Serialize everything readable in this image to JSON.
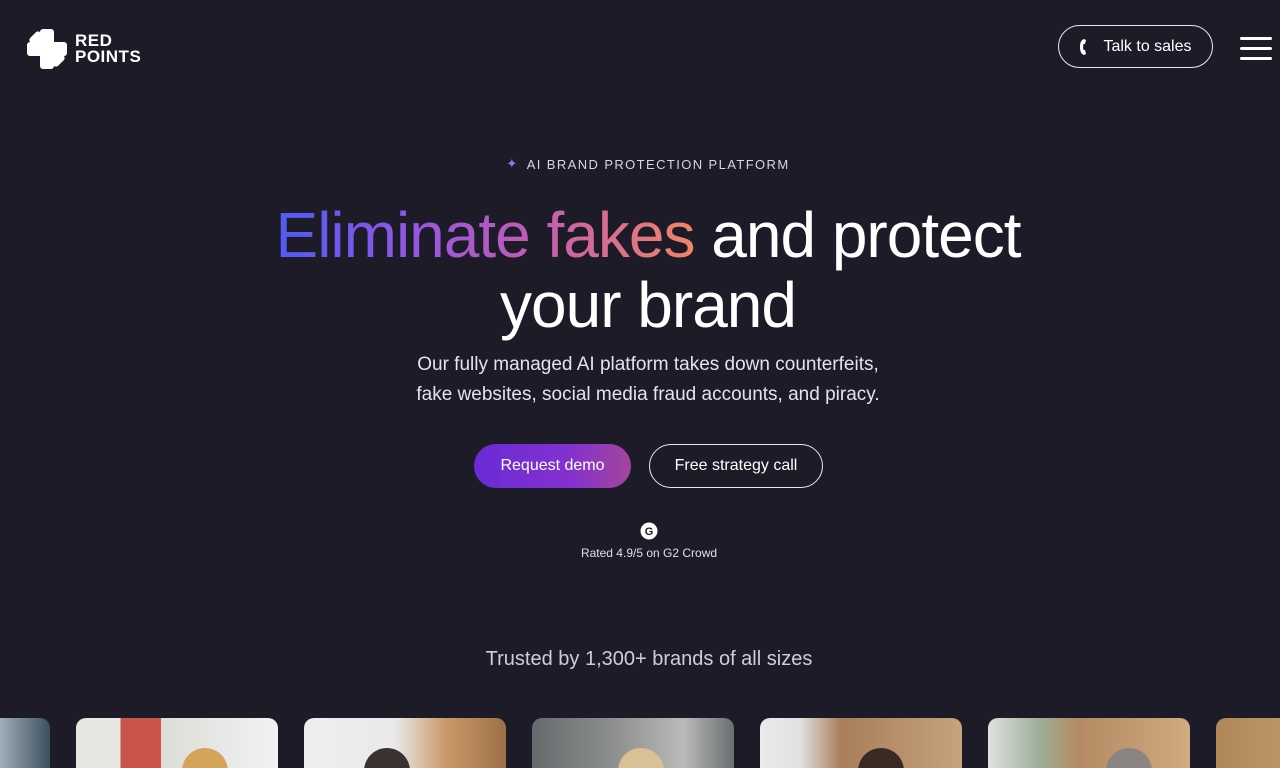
{
  "brand": {
    "line1": "RED",
    "line2": "POINTS"
  },
  "header": {
    "talk_label": "Talk to sales"
  },
  "hero": {
    "eyebrow": "AI BRAND PROTECTION PLATFORM",
    "headline_gradient": "Eliminate fakes",
    "headline_rest": " and protect",
    "headline_line2": "your brand",
    "sub_line1": "Our fully managed AI platform takes down counterfeits,",
    "sub_line2": "fake websites, social media fraud accounts, and piracy.",
    "cta_primary": "Request demo",
    "cta_secondary": "Free strategy call",
    "rating": "Rated 4.9/5 on G2 Crowd"
  },
  "trusted": {
    "text": "Trusted by 1,300+ brands of all sizes"
  },
  "colors": {
    "background": "#1d1b28",
    "accent_purple": "#7a2fd6",
    "gradient_start": "#4f5bf5",
    "gradient_end": "#f18565"
  },
  "icons": {
    "logo": "redpoints-logo-icon",
    "phone": "phone-icon",
    "menu": "hamburger-menu-icon",
    "sparkle": "sparkle-icon",
    "g2": "g2-logo-icon"
  }
}
